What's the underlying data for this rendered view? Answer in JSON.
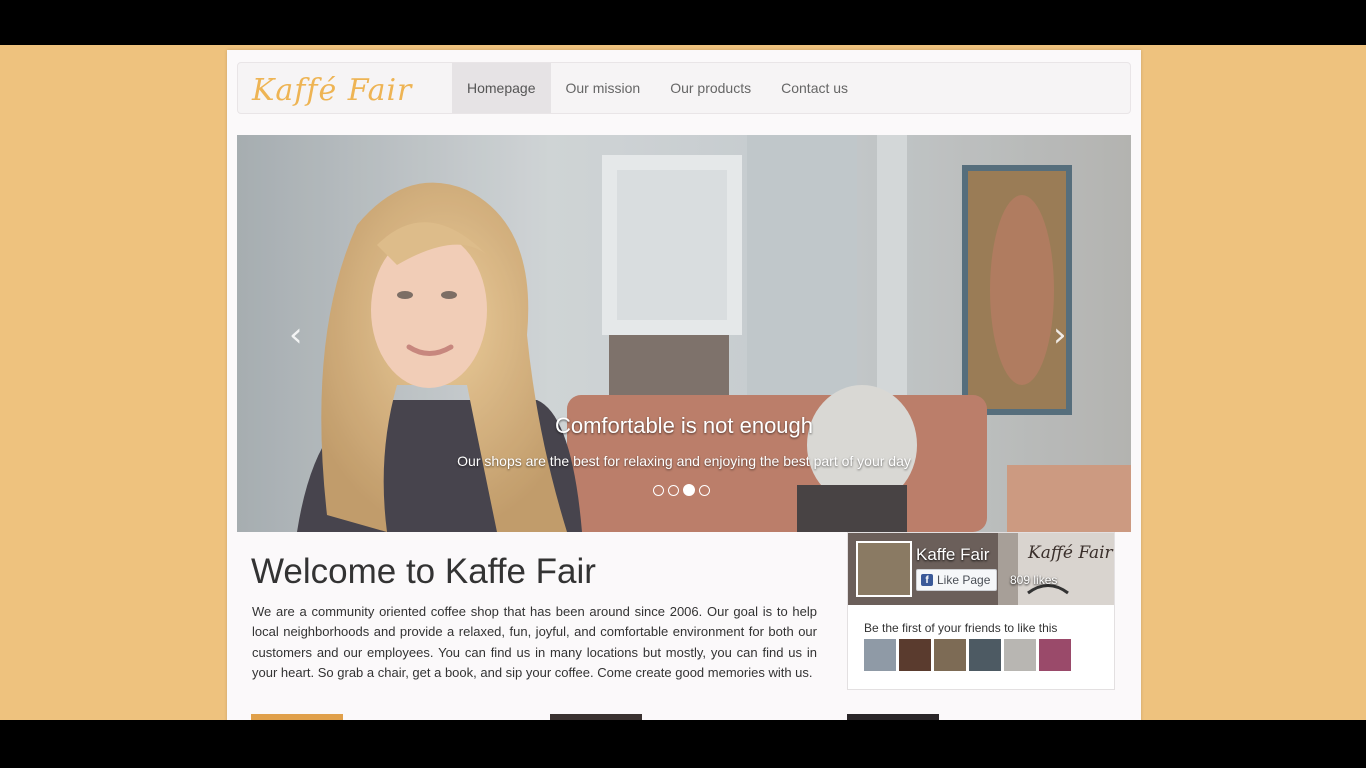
{
  "brand": {
    "name": "Kaffé Fair"
  },
  "nav": {
    "items": [
      {
        "label": "Homepage",
        "active": true
      },
      {
        "label": "Our mission",
        "active": false
      },
      {
        "label": "Our products",
        "active": false
      },
      {
        "label": "Contact us",
        "active": false
      }
    ]
  },
  "carousel": {
    "title": "Comfortable is not enough",
    "text": "Our shops are the best for relaxing and enjoying the best part of your day",
    "prev_icon": "‹",
    "next_icon": "›",
    "active_slide": 3,
    "slide_count": 4
  },
  "welcome": {
    "title": "Welcome to Kaffe Fair",
    "text": "We are a community oriented coffee shop that has been around since 2006. Our goal is to help local neighborhoods and provide a relaxed, fun, joyful, and comfortable environment for both our customers and our employees. You can find us in many locations but mostly, you can find us in your heart. So grab a chair, get a book, and sip your coffee. Come create good memories with us."
  },
  "facebook": {
    "page_name": "Kaffe Fair",
    "like_button": "Like Page",
    "likes": "809 likes",
    "cover_text": "Kaffé Fair",
    "friends_text": "Be the first of your friends to like this",
    "fb_glyph": "f"
  },
  "colors": {
    "background": "#eec27e",
    "brand": "#eeb454"
  }
}
